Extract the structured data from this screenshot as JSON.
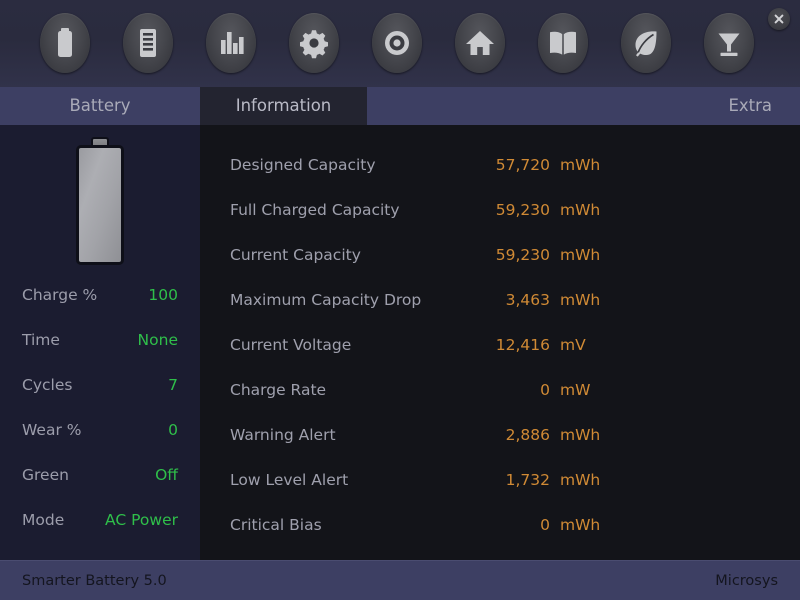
{
  "app": {
    "name": "Smarter Battery 5.0",
    "vendor": "Microsys"
  },
  "colors": {
    "toolbar_bg": "#2a2b3e",
    "tabbar_bg": "#3d3f63",
    "active_tab_bg": "#232430",
    "left_panel_bg": "#1b1c30",
    "main_panel_bg": "#131419",
    "value_green": "#2fbf4a",
    "value_orange": "#d08a35",
    "label_gray": "#9fa0ad",
    "statusbar_bg": "#3d3f63"
  },
  "toolbar": {
    "buttons": [
      {
        "name": "battery-icon",
        "label": "Battery"
      },
      {
        "name": "list-icon",
        "label": "Details"
      },
      {
        "name": "bar-chart-icon",
        "label": "Statistics"
      },
      {
        "name": "gear-icon",
        "label": "Settings"
      },
      {
        "name": "target-icon",
        "label": "Calibrate"
      },
      {
        "name": "home-icon",
        "label": "Home"
      },
      {
        "name": "book-icon",
        "label": "Help"
      },
      {
        "name": "leaf-icon",
        "label": "Green Mode"
      },
      {
        "name": "funnel-icon",
        "label": "Export"
      }
    ],
    "close_label": "×"
  },
  "tabs": [
    {
      "label": "Battery",
      "active": false
    },
    {
      "label": "Information",
      "active": true
    },
    {
      "label": "Extra",
      "active": false
    }
  ],
  "battery_panel": {
    "charge_level_percent": 100,
    "rows": [
      {
        "label": "Charge %",
        "value": "100"
      },
      {
        "label": "Time",
        "value": "None"
      },
      {
        "label": "Cycles",
        "value": "7"
      },
      {
        "label": "Wear %",
        "value": "0"
      },
      {
        "label": "Green",
        "value": "Off"
      },
      {
        "label": "Mode",
        "value": "AC Power"
      }
    ]
  },
  "information_panel": {
    "rows": [
      {
        "label": "Designed Capacity",
        "value": "57,720",
        "unit": "mWh"
      },
      {
        "label": "Full Charged Capacity",
        "value": "59,230",
        "unit": "mWh"
      },
      {
        "label": "Current Capacity",
        "value": "59,230",
        "unit": "mWh"
      },
      {
        "label": "Maximum Capacity Drop",
        "value": "3,463",
        "unit": "mWh"
      },
      {
        "label": "Current Voltage",
        "value": "12,416",
        "unit": "mV"
      },
      {
        "label": "Charge Rate",
        "value": "0",
        "unit": "mW"
      },
      {
        "label": "Warning Alert",
        "value": "2,886",
        "unit": "mWh"
      },
      {
        "label": "Low Level Alert",
        "value": "1,732",
        "unit": "mWh"
      },
      {
        "label": "Critical Bias",
        "value": "0",
        "unit": "mWh"
      }
    ]
  }
}
